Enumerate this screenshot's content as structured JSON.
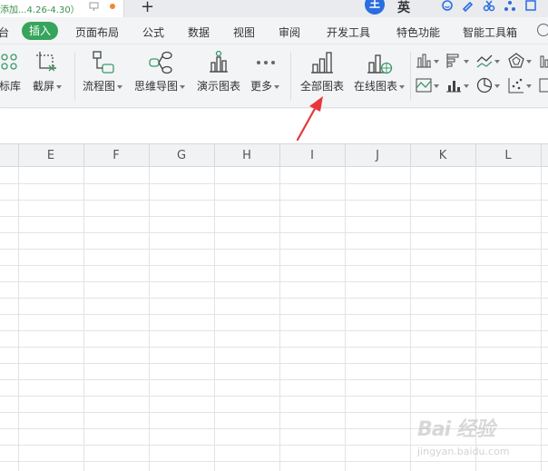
{
  "titlebar": {
    "doc_tab_title": "添加...4.26-4.30）",
    "new_tab_label": "+",
    "user_initial": "王",
    "user_name_fragment": "英"
  },
  "menu": {
    "items": [
      {
        "label": "台"
      },
      {
        "label": "插入"
      },
      {
        "label": "页面布局"
      },
      {
        "label": "公式"
      },
      {
        "label": "数据"
      },
      {
        "label": "视图"
      },
      {
        "label": "审阅"
      },
      {
        "label": "开发工具"
      },
      {
        "label": "特色功能"
      },
      {
        "label": "智能工具箱"
      }
    ],
    "active": "插入"
  },
  "ribbon": {
    "buttons": [
      {
        "label": "标库",
        "icon": "icon-library-icon"
      },
      {
        "label": "截屏",
        "icon": "screenshot-icon"
      },
      {
        "label": "流程图",
        "icon": "flowchart-icon"
      },
      {
        "label": "思维导图",
        "icon": "mindmap-icon"
      },
      {
        "label": "演示图表",
        "icon": "demo-chart-icon"
      },
      {
        "label": "更多",
        "icon": "more-dots-icon"
      },
      {
        "label": "全部图表",
        "icon": "all-charts-icon"
      },
      {
        "label": "在线图表",
        "icon": "online-chart-icon"
      }
    ],
    "small_icons": [
      "column-chart-icon",
      "bar-chart-icon",
      "line-chart-icon",
      "radar-chart-icon",
      "area-chart-icon",
      "stock-chart-icon",
      "pie-chart-icon",
      "scatter-chart-icon"
    ]
  },
  "columns": [
    "E",
    "F",
    "G",
    "H",
    "I",
    "J",
    "K",
    "L"
  ],
  "watermark": {
    "logo": "Bai 经验",
    "url": "jingyan.baidu.com"
  },
  "colors": {
    "accent": "#36a45b",
    "arrow": "#e8373b",
    "menubar_bg": "#f3f4f6",
    "grid_line": "#e1e3e6"
  }
}
